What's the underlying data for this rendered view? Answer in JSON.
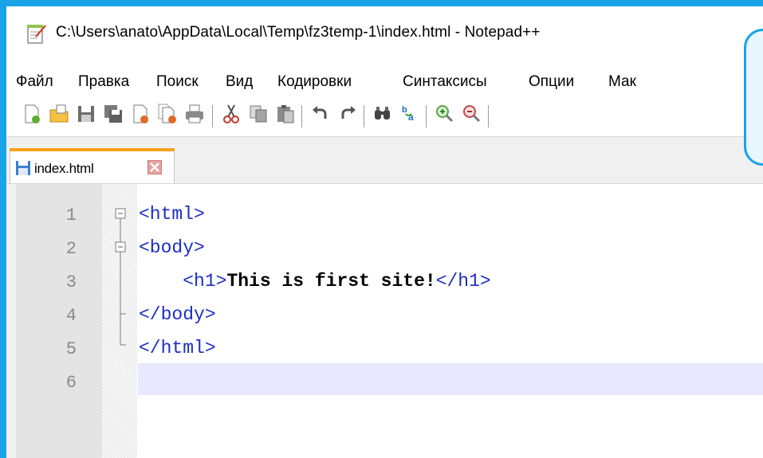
{
  "window": {
    "title": "C:\\Users\\anato\\AppData\\Local\\Temp\\fz3temp-1\\index.html - Notepad++"
  },
  "menu": {
    "items": [
      "Файл",
      "Правка",
      "Поиск",
      "Вид",
      "Кодировки",
      "Синтаксисы",
      "Опции",
      "Мак"
    ]
  },
  "toolbar": {
    "buttons": [
      "new-file-icon",
      "open-file-icon",
      "save-icon",
      "save-all-icon",
      "close-icon",
      "close-all-icon",
      "print-icon",
      "cut-icon",
      "copy-icon",
      "paste-icon",
      "undo-icon",
      "redo-icon",
      "find-icon",
      "replace-icon",
      "zoom-in-icon",
      "zoom-out-icon"
    ]
  },
  "tabs": [
    {
      "label": "index.html",
      "active": true
    }
  ],
  "editor": {
    "line_numbers": [
      "1",
      "2",
      "3",
      "4",
      "5",
      "6"
    ],
    "lines": [
      {
        "tag": "<html>"
      },
      {
        "tag": "<body>"
      },
      {
        "indent": "    ",
        "open": "<h1>",
        "text": "This is first site!",
        "close": "</h1>"
      },
      {
        "tag": "</body>"
      },
      {
        "tag": "</html>"
      },
      {
        "tag": ""
      }
    ]
  },
  "colors": {
    "accent": "#1aa3e6",
    "tag": "#1c2ec4",
    "tab_active": "#f7a11a",
    "current_line": "#e8e8ff"
  }
}
